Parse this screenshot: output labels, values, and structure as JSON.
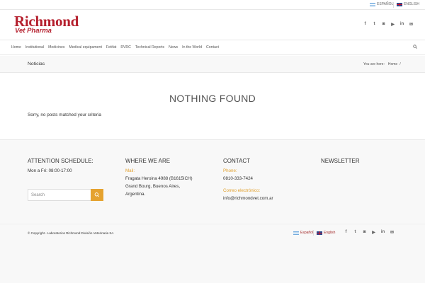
{
  "topbar": {
    "languages": [
      {
        "label": "ESPAÑOL",
        "flag": "argentina-flag-icon"
      },
      {
        "label": "ENGLISH",
        "flag": "uk-flag-icon"
      }
    ]
  },
  "header": {
    "logo_main": "Richmond",
    "logo_sub": "Vet Pharma",
    "social": [
      "f",
      "t",
      "◙",
      "▶",
      "in",
      "✉"
    ]
  },
  "nav": {
    "items": [
      "Home",
      "Institutional",
      "Medicines",
      "Medical equipament",
      "Fetifat",
      "RVRC",
      "Technical Reports",
      "News",
      "In the World",
      "Contact"
    ]
  },
  "titlebar": {
    "title": "Noticias",
    "crumb_prefix": "You are here:",
    "crumb_home": "Home",
    "crumb_sep": "/"
  },
  "main": {
    "heading": "NOTHING FOUND",
    "message": "Sorry, no posts matched your criteria"
  },
  "footer": {
    "col1": {
      "heading": "ATTENTION SCHEDULE:",
      "text": "Mon a Fri: 08:00-17:00",
      "search_placeholder": "Search"
    },
    "col2": {
      "heading": "WHERE WE ARE",
      "label": "Mail:",
      "line1": "Fragata Heroina 4988 (B1615ICH)",
      "line2": "Grand Bourg, Buenos Aires,",
      "line3": "Argentina."
    },
    "col3": {
      "heading": "CONTACT",
      "phone_label": "Phone:",
      "phone": "0810-333-7424",
      "email_label": "Correo electrónico:",
      "email": "info@richmondvet.com.ar"
    },
    "col4": {
      "heading": "NEWSLETTER"
    }
  },
  "socket": {
    "copyright": "© Copyright - Laboratorios Richmond División Veterinaria SA",
    "lang_es": "Español",
    "lang_en": "English"
  },
  "colors": {
    "brand": "#b5202e",
    "accent": "#e5a22f"
  }
}
